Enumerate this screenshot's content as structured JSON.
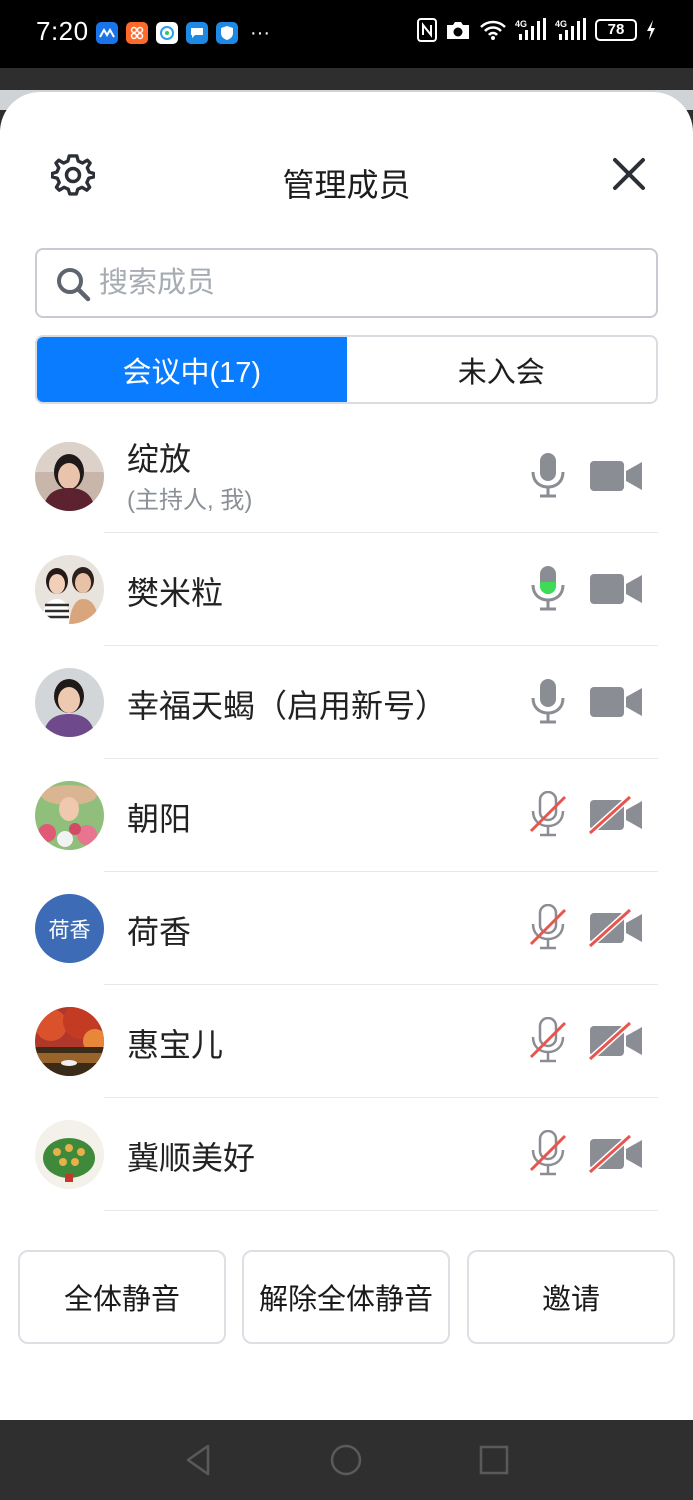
{
  "status_bar": {
    "time": "7:20",
    "battery": "78",
    "icons": [
      "app-icon-blue",
      "app-icon-orange",
      "app-icon-chat",
      "app-icon-message",
      "app-icon-shield",
      "more-icon",
      "nfc-icon",
      "camera-icon",
      "wifi-icon",
      "signal-4g-icon",
      "signal-4g-icon",
      "battery-icon",
      "charging-icon"
    ],
    "more": "···"
  },
  "header": {
    "title": "管理成员",
    "settings_icon": "gear-icon",
    "close_icon": "close-icon"
  },
  "search": {
    "placeholder": "搜索成员",
    "value": ""
  },
  "tabs": [
    {
      "label": "会议中(17)",
      "active": true
    },
    {
      "label": "未入会",
      "active": false
    }
  ],
  "members": [
    {
      "name": "绽放",
      "subtitle": "(主持人, 我)",
      "mic": "on",
      "camera": "on",
      "avatar": "photo"
    },
    {
      "name": "樊米粒",
      "subtitle": "",
      "mic": "speaking",
      "camera": "on",
      "avatar": "photo"
    },
    {
      "name": "幸福天蝎（启用新号）",
      "subtitle": "",
      "mic": "on",
      "camera": "on",
      "avatar": "photo"
    },
    {
      "name": "朝阳",
      "subtitle": "",
      "mic": "muted",
      "camera": "off",
      "avatar": "photo"
    },
    {
      "name": "荷香",
      "subtitle": "",
      "mic": "muted",
      "camera": "off",
      "avatar": "text",
      "avatar_text": "荷香"
    },
    {
      "name": "惠宝儿",
      "subtitle": "",
      "mic": "muted",
      "camera": "off",
      "avatar": "photo"
    },
    {
      "name": "冀顺美好",
      "subtitle": "",
      "mic": "muted",
      "camera": "off",
      "avatar": "photo"
    }
  ],
  "footer": {
    "mute_all": "全体静音",
    "unmute_all": "解除全体静音",
    "invite": "邀请"
  },
  "colors": {
    "accent": "#0a7cff",
    "speaking": "#3ddc57",
    "muted_slash": "#e8554e",
    "icon_gray": "#8a8e94"
  },
  "nav": [
    "back-icon",
    "home-icon",
    "recents-icon"
  ]
}
